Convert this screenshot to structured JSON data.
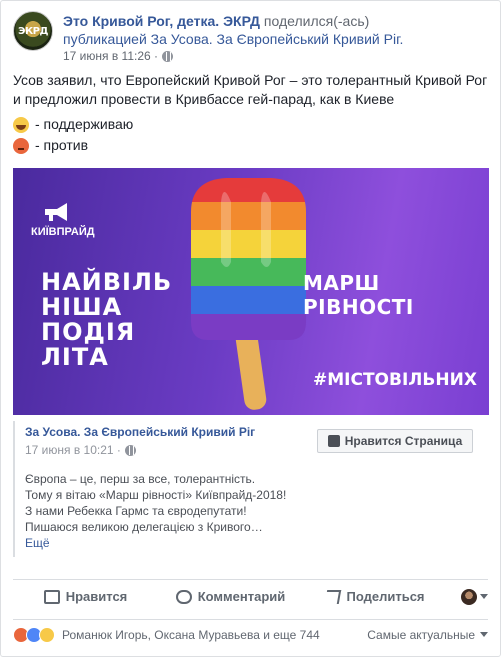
{
  "header": {
    "page_name": "Это Кривой Рог, детка. ЭКРД",
    "action_text": "поделился(-ась)",
    "action_text2": "публикацией",
    "shared_page": "За Усова. За Європейський Кривий Ріг.",
    "timestamp": "17 июня в 11:26 ·",
    "avatar_text": "ЭКРД"
  },
  "post": {
    "text": "Усов заявил, что Европейский Кривой Рог – это толерантный Кривой Рог и предложил провести в Кривбассе гей-парад, как в Киеве",
    "option_support": "- поддерживаю",
    "option_against": "- против"
  },
  "image": {
    "logo_text": "КИЇВПРАЙД",
    "slogan": [
      "НАЙВІЛЬ",
      "НІША",
      "ПОДІЯ",
      "ЛІТА"
    ],
    "march": "МАРШ РІВНОСТІ",
    "hashtag": "#МІСТОВІЛЬНИХ"
  },
  "shared_preview": {
    "title": "За Усова. За Європейський Кривий Ріг",
    "timestamp": "17 июня в 10:21 ·",
    "like_page_label": "Нравится Страница",
    "lines": [
      "Європа – це, перш за все, толерантність.",
      "Тому я вітаю «Марш рівності» Київпрайд-2018!",
      "З нами Ребекка Гармс та євродепутати!",
      "Пишаюся великою делегацією з Кривого…"
    ],
    "more_label": "Ещё"
  },
  "actions": {
    "like": "Нравится",
    "comment": "Комментарий",
    "share": "Поделиться"
  },
  "reactions": {
    "names": "Романюк Игорь, Оксана Муравьева и еще 744",
    "sort_label": "Самые актуальные"
  },
  "colors": {
    "link": "#365899",
    "image_bg": "#6b3cc4"
  }
}
